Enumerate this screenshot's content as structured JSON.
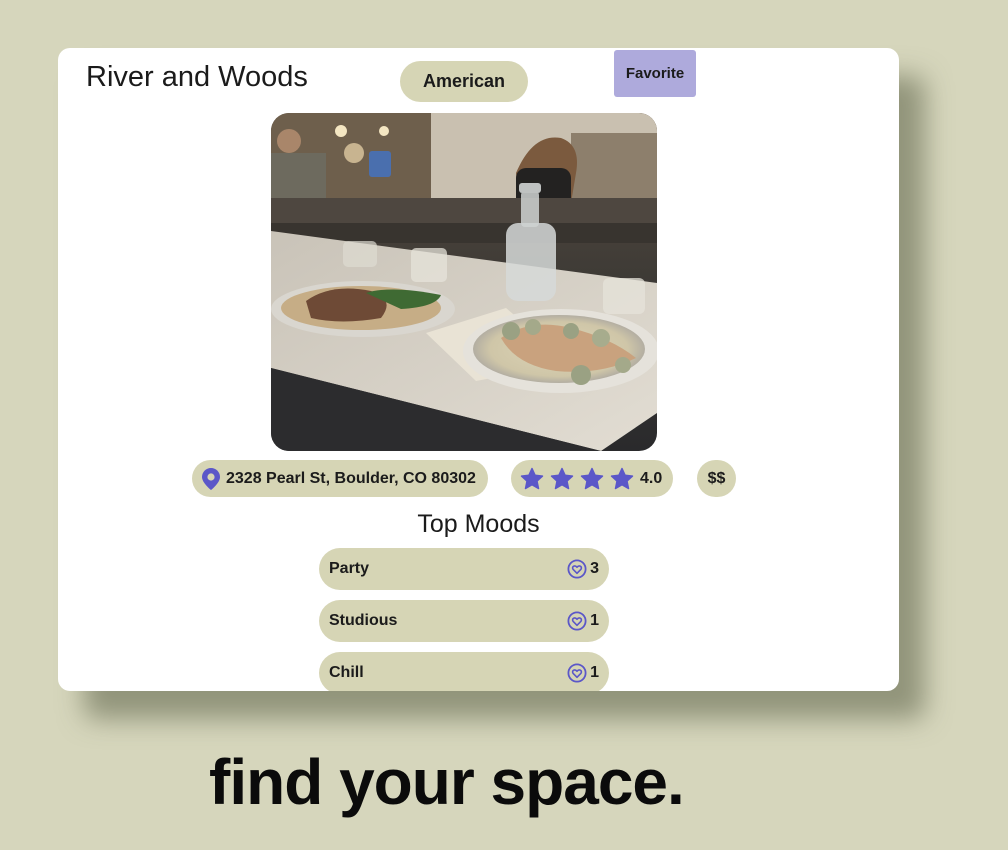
{
  "restaurant": {
    "name": "River and Woods",
    "cuisine": "American",
    "favorite_label": "Favorite",
    "address": "2328 Pearl St, Boulder, CO 80302",
    "rating": 4.0,
    "rating_text": "4.0",
    "stars_shown": 4,
    "price": "$$"
  },
  "moods": {
    "title": "Top Moods",
    "items": [
      {
        "label": "Party",
        "count": "3"
      },
      {
        "label": "Studious",
        "count": "1"
      },
      {
        "label": "Chill",
        "count": "1"
      }
    ]
  },
  "tagline": "find your space.",
  "colors": {
    "background": "#d6d6bc",
    "pill": "#d6d5b5",
    "favorite_button": "#aeaadc",
    "accent_icon": "#5b57c8"
  },
  "icons": {
    "location": "map-pin-icon",
    "rating": "star-icon",
    "mood": "heart-badge-icon"
  }
}
